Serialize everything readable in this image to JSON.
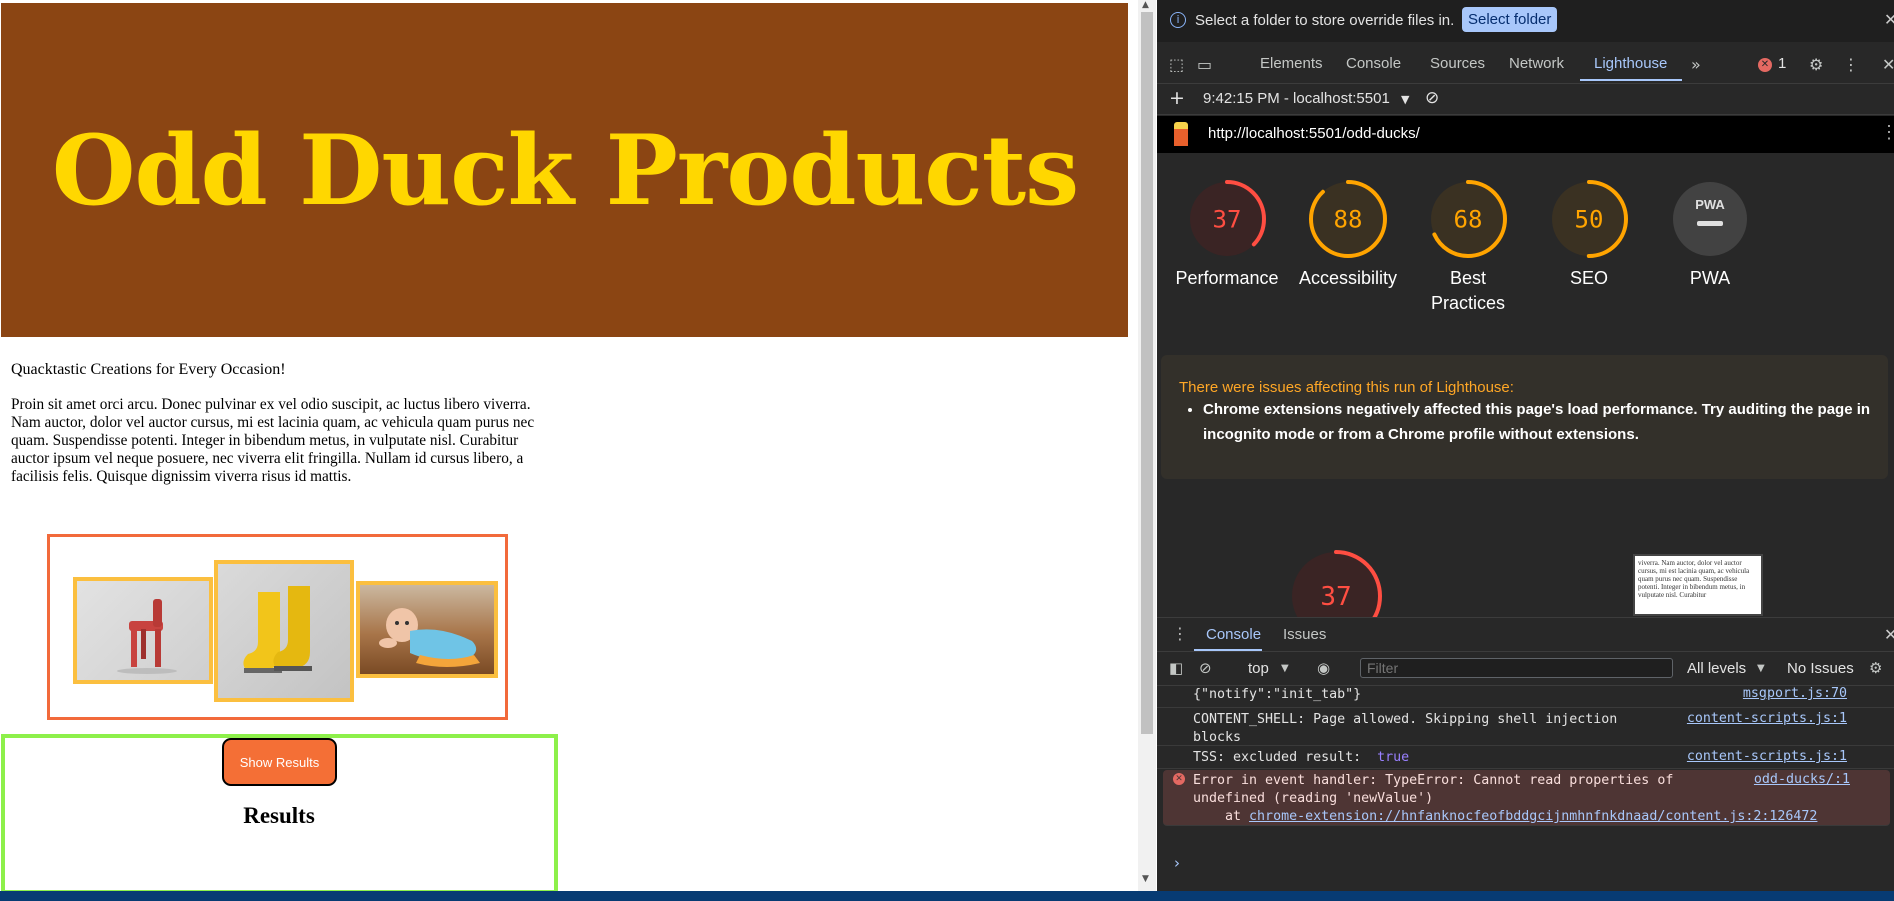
{
  "page": {
    "title": "Odd Duck Products",
    "tagline": "Quacktastic Creations for Every Occasion!",
    "intro": "Proin sit amet orci arcu. Donec pulvinar ex vel odio suscipit, ac luctus libero viverra. Nam auctor, dolor vel auctor cursus, mi est lacinia quam, ac vehicula quam purus nec quam. Suspendisse potenti. Integer in bibendum metus, in vulputate nisl. Curabitur auctor ipsum vel neque posuere, nec viverra elit fringilla. Nullam id cursus libero, a facilisis felis. Quisque dignissim viverra risus id mattis.",
    "products": [
      "chair",
      "boots",
      "baby"
    ],
    "show_results_label": "Show Results",
    "results_title": "Results"
  },
  "devtools": {
    "infobar": {
      "message": "Select a folder to store override files in.",
      "button": "Select folder"
    },
    "tabs": [
      "Elements",
      "Console",
      "Sources",
      "Network",
      "Lighthouse"
    ],
    "active_tab": "Lighthouse",
    "error_count": "1",
    "report": {
      "time_host": "9:42:15 PM - localhost:5501",
      "url": "http://localhost:5501/odd-ducks/"
    },
    "scores": [
      {
        "label": "Performance",
        "value": "37",
        "fraction": 0.37,
        "color": "#ff4e42"
      },
      {
        "label": "Accessibility",
        "value": "88",
        "fraction": 0.88,
        "color": "#ffa400"
      },
      {
        "label": "Best\nPractices",
        "value": "68",
        "fraction": 0.68,
        "color": "#ffa400"
      },
      {
        "label": "SEO",
        "value": "50",
        "fraction": 0.5,
        "color": "#ffa400"
      },
      {
        "label": "PWA",
        "value": "PWA",
        "fraction": 0,
        "color": "#e0e0e0"
      }
    ],
    "warning": {
      "title": "There were issues affecting this run of Lighthouse:",
      "items": [
        "Chrome extensions negatively affected this page's load performance. Try auditing the page in incognito mode or from a Chrome profile without extensions."
      ]
    },
    "big_score": {
      "value": "37",
      "fraction": 0.37,
      "color": "#ff4e42"
    },
    "preview_text": "viverra. Nam auctor, dolor vel auctor cursus, mi est lacinia quam, ac vehicula quam purus nec quam. Suspendisse potenti. Integer in bibendum metus, in vulputate nisl. Curabitur",
    "drawer": {
      "tabs": [
        "Console",
        "Issues"
      ],
      "context": "top",
      "filter_placeholder": "Filter",
      "levels": "All levels",
      "issues": "No Issues"
    },
    "logs": [
      {
        "text": "{\"notify\":\"init_tab\"}",
        "source": "msgport.js:70"
      },
      {
        "text": "CONTENT_SHELL: Page allowed. Skipping shell injection\nblocks",
        "source": "content-scripts.js:1"
      },
      {
        "text": "TSS: excluded result:  ",
        "value": "true",
        "source": "content-scripts.js:1"
      },
      {
        "text": "Error in event handler: TypeError: Cannot read properties of\nundefined (reading 'newValue')\n    at ",
        "link": "chrome-extension://hnfanknocfeofbddgcijnmhnfnkdnaad/content.js:2:126472",
        "source": "odd-ducks/:1",
        "level": "error"
      }
    ]
  }
}
